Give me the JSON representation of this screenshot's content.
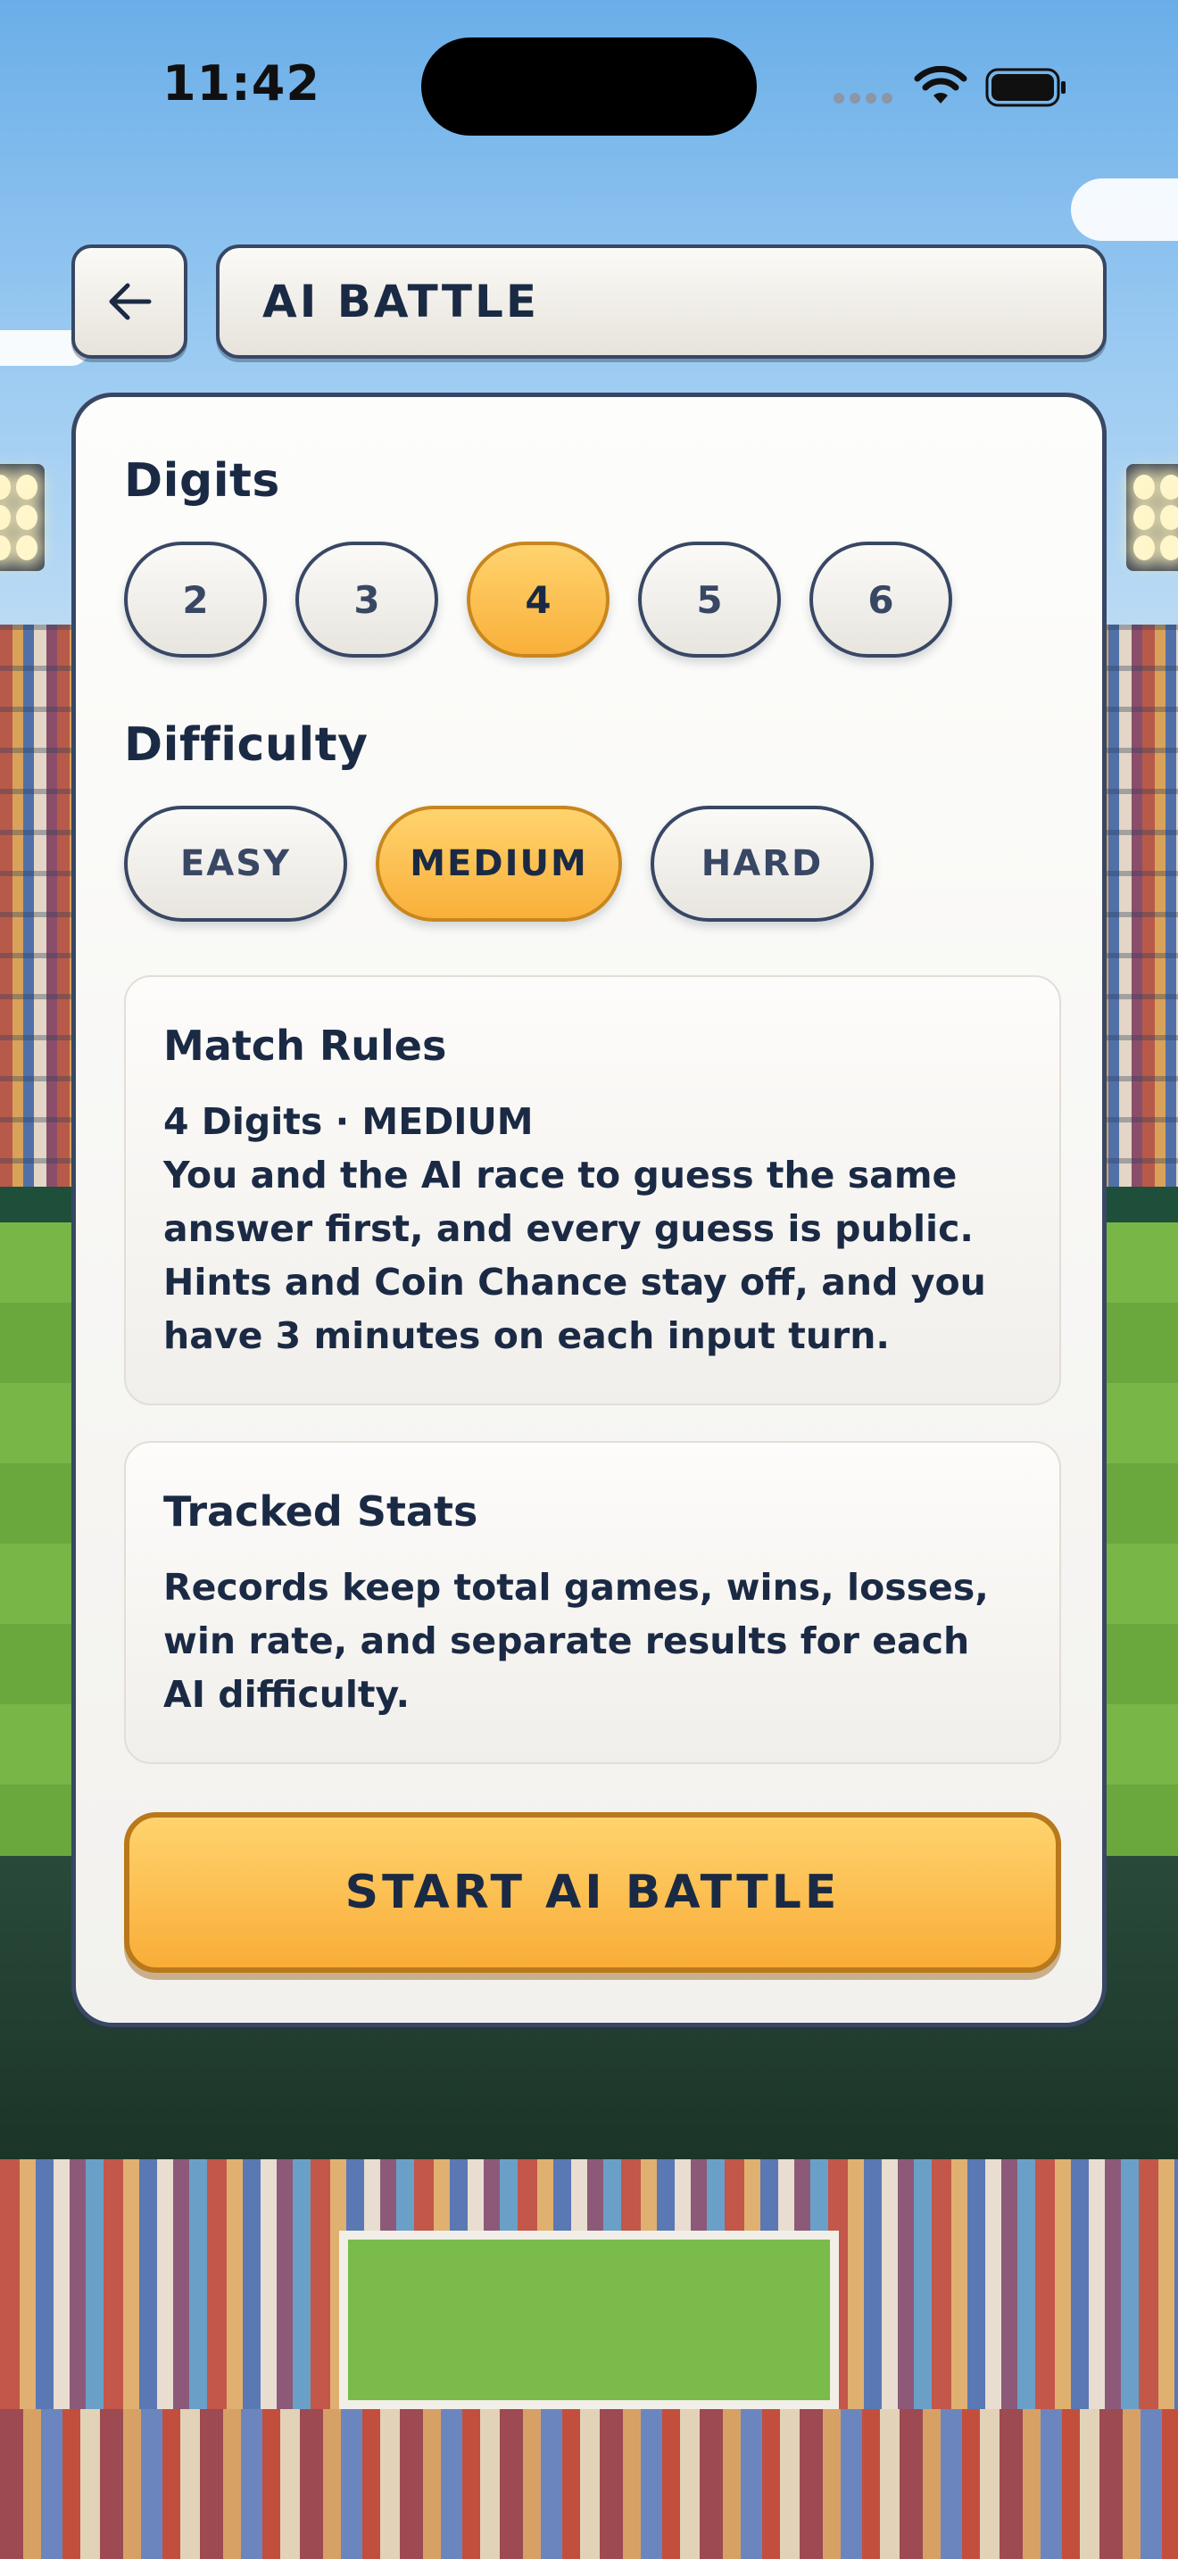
{
  "status_bar": {
    "time": "11:42"
  },
  "header": {
    "back_icon": "arrow-left-icon",
    "title": "AI BATTLE"
  },
  "digits": {
    "heading": "Digits",
    "options": [
      "2",
      "3",
      "4",
      "5",
      "6"
    ],
    "selected": "4"
  },
  "difficulty": {
    "heading": "Difficulty",
    "options": [
      "EASY",
      "MEDIUM",
      "HARD"
    ],
    "selected": "MEDIUM"
  },
  "match_rules": {
    "title": "Match Rules",
    "summary": "4 Digits · MEDIUM",
    "body": "You and the AI race to guess the same answer first, and every guess is public. Hints and Coin Chance stay off, and you have 3 minutes on each input turn."
  },
  "tracked_stats": {
    "title": "Tracked Stats",
    "body": "Records keep total games, wins, losses, win rate, and separate results for each AI difficulty."
  },
  "start_button": {
    "label": "START AI BATTLE"
  },
  "colors": {
    "accent": "#f9b03a",
    "border": "#384764",
    "text": "#1b2a44"
  }
}
